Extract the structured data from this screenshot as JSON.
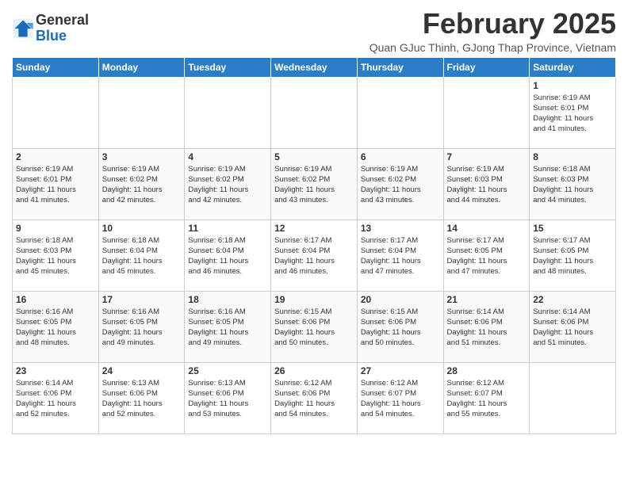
{
  "header": {
    "logo_general": "General",
    "logo_blue": "Blue",
    "month_title": "February 2025",
    "subtitle": "Quan GJuc Thinh, GJong Thap Province, Vietnam"
  },
  "weekdays": [
    "Sunday",
    "Monday",
    "Tuesday",
    "Wednesday",
    "Thursday",
    "Friday",
    "Saturday"
  ],
  "weeks": [
    [
      {
        "day": "",
        "info": ""
      },
      {
        "day": "",
        "info": ""
      },
      {
        "day": "",
        "info": ""
      },
      {
        "day": "",
        "info": ""
      },
      {
        "day": "",
        "info": ""
      },
      {
        "day": "",
        "info": ""
      },
      {
        "day": "1",
        "info": "Sunrise: 6:19 AM\nSunset: 6:01 PM\nDaylight: 11 hours\nand 41 minutes."
      }
    ],
    [
      {
        "day": "2",
        "info": "Sunrise: 6:19 AM\nSunset: 6:01 PM\nDaylight: 11 hours\nand 41 minutes."
      },
      {
        "day": "3",
        "info": "Sunrise: 6:19 AM\nSunset: 6:02 PM\nDaylight: 11 hours\nand 42 minutes."
      },
      {
        "day": "4",
        "info": "Sunrise: 6:19 AM\nSunset: 6:02 PM\nDaylight: 11 hours\nand 42 minutes."
      },
      {
        "day": "5",
        "info": "Sunrise: 6:19 AM\nSunset: 6:02 PM\nDaylight: 11 hours\nand 43 minutes."
      },
      {
        "day": "6",
        "info": "Sunrise: 6:19 AM\nSunset: 6:02 PM\nDaylight: 11 hours\nand 43 minutes."
      },
      {
        "day": "7",
        "info": "Sunrise: 6:19 AM\nSunset: 6:03 PM\nDaylight: 11 hours\nand 44 minutes."
      },
      {
        "day": "8",
        "info": "Sunrise: 6:18 AM\nSunset: 6:03 PM\nDaylight: 11 hours\nand 44 minutes."
      }
    ],
    [
      {
        "day": "9",
        "info": "Sunrise: 6:18 AM\nSunset: 6:03 PM\nDaylight: 11 hours\nand 45 minutes."
      },
      {
        "day": "10",
        "info": "Sunrise: 6:18 AM\nSunset: 6:04 PM\nDaylight: 11 hours\nand 45 minutes."
      },
      {
        "day": "11",
        "info": "Sunrise: 6:18 AM\nSunset: 6:04 PM\nDaylight: 11 hours\nand 46 minutes."
      },
      {
        "day": "12",
        "info": "Sunrise: 6:17 AM\nSunset: 6:04 PM\nDaylight: 11 hours\nand 46 minutes."
      },
      {
        "day": "13",
        "info": "Sunrise: 6:17 AM\nSunset: 6:04 PM\nDaylight: 11 hours\nand 47 minutes."
      },
      {
        "day": "14",
        "info": "Sunrise: 6:17 AM\nSunset: 6:05 PM\nDaylight: 11 hours\nand 47 minutes."
      },
      {
        "day": "15",
        "info": "Sunrise: 6:17 AM\nSunset: 6:05 PM\nDaylight: 11 hours\nand 48 minutes."
      }
    ],
    [
      {
        "day": "16",
        "info": "Sunrise: 6:16 AM\nSunset: 6:05 PM\nDaylight: 11 hours\nand 48 minutes."
      },
      {
        "day": "17",
        "info": "Sunrise: 6:16 AM\nSunset: 6:05 PM\nDaylight: 11 hours\nand 49 minutes."
      },
      {
        "day": "18",
        "info": "Sunrise: 6:16 AM\nSunset: 6:05 PM\nDaylight: 11 hours\nand 49 minutes."
      },
      {
        "day": "19",
        "info": "Sunrise: 6:15 AM\nSunset: 6:06 PM\nDaylight: 11 hours\nand 50 minutes."
      },
      {
        "day": "20",
        "info": "Sunrise: 6:15 AM\nSunset: 6:06 PM\nDaylight: 11 hours\nand 50 minutes."
      },
      {
        "day": "21",
        "info": "Sunrise: 6:14 AM\nSunset: 6:06 PM\nDaylight: 11 hours\nand 51 minutes."
      },
      {
        "day": "22",
        "info": "Sunrise: 6:14 AM\nSunset: 6:06 PM\nDaylight: 11 hours\nand 51 minutes."
      }
    ],
    [
      {
        "day": "23",
        "info": "Sunrise: 6:14 AM\nSunset: 6:06 PM\nDaylight: 11 hours\nand 52 minutes."
      },
      {
        "day": "24",
        "info": "Sunrise: 6:13 AM\nSunset: 6:06 PM\nDaylight: 11 hours\nand 52 minutes."
      },
      {
        "day": "25",
        "info": "Sunrise: 6:13 AM\nSunset: 6:06 PM\nDaylight: 11 hours\nand 53 minutes."
      },
      {
        "day": "26",
        "info": "Sunrise: 6:12 AM\nSunset: 6:06 PM\nDaylight: 11 hours\nand 54 minutes."
      },
      {
        "day": "27",
        "info": "Sunrise: 6:12 AM\nSunset: 6:07 PM\nDaylight: 11 hours\nand 54 minutes."
      },
      {
        "day": "28",
        "info": "Sunrise: 6:12 AM\nSunset: 6:07 PM\nDaylight: 11 hours\nand 55 minutes."
      },
      {
        "day": "",
        "info": ""
      }
    ]
  ]
}
